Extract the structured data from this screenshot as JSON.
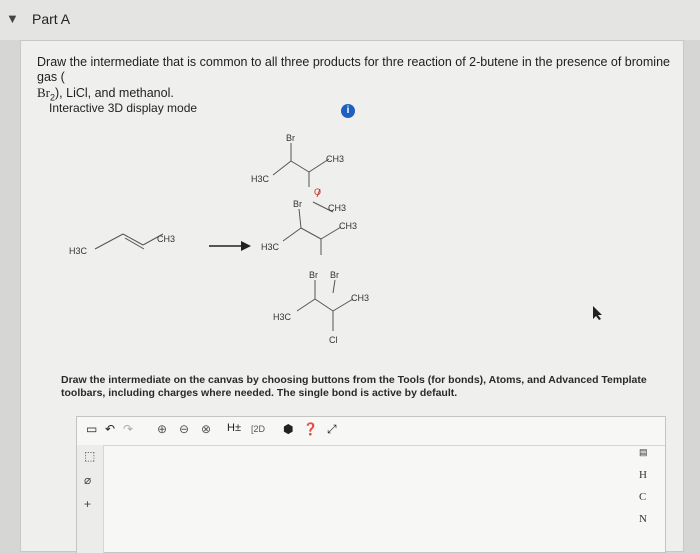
{
  "header": {
    "title": "Part A",
    "chevron": "▼"
  },
  "question": {
    "text_start": "Draw the intermediate that is common to all three products for thre reaction of 2-butene in the presence of bromine gas (",
    "formula_br": "Br",
    "formula_sub": "2",
    "text_end": "), LiCl, and methanol."
  },
  "display_mode": {
    "label": "Interactive 3D display mode",
    "info_icon": "i"
  },
  "scheme": {
    "reactant": {
      "left_group": "H3C",
      "right_group": "CH3"
    },
    "product_top": {
      "br": "Br",
      "ch3": "CH3",
      "h3c": "H3C",
      "o": "O"
    },
    "product_mid": {
      "br": "Br",
      "ch3_top": "CH3",
      "ch3": "CH3",
      "h3c": "H3C"
    },
    "product_bottom": {
      "br1": "Br",
      "br2": "Br",
      "ch3": "CH3",
      "h3c": "H3C",
      "cl": "Cl"
    }
  },
  "instructions": "Draw the intermediate on the canvas by choosing buttons from the Tools (for bonds), Atoms, and Advanced Template toolbars, including charges where needed. The single bond is active by default.",
  "toolbar": {
    "h_label": "H±",
    "template_label": "[2D"
  },
  "atoms_toolbar": {
    "items": [
      "H",
      "C",
      "N"
    ]
  },
  "colors": {
    "accent": "#1f5fbf",
    "oxygen": "#c0392b"
  }
}
